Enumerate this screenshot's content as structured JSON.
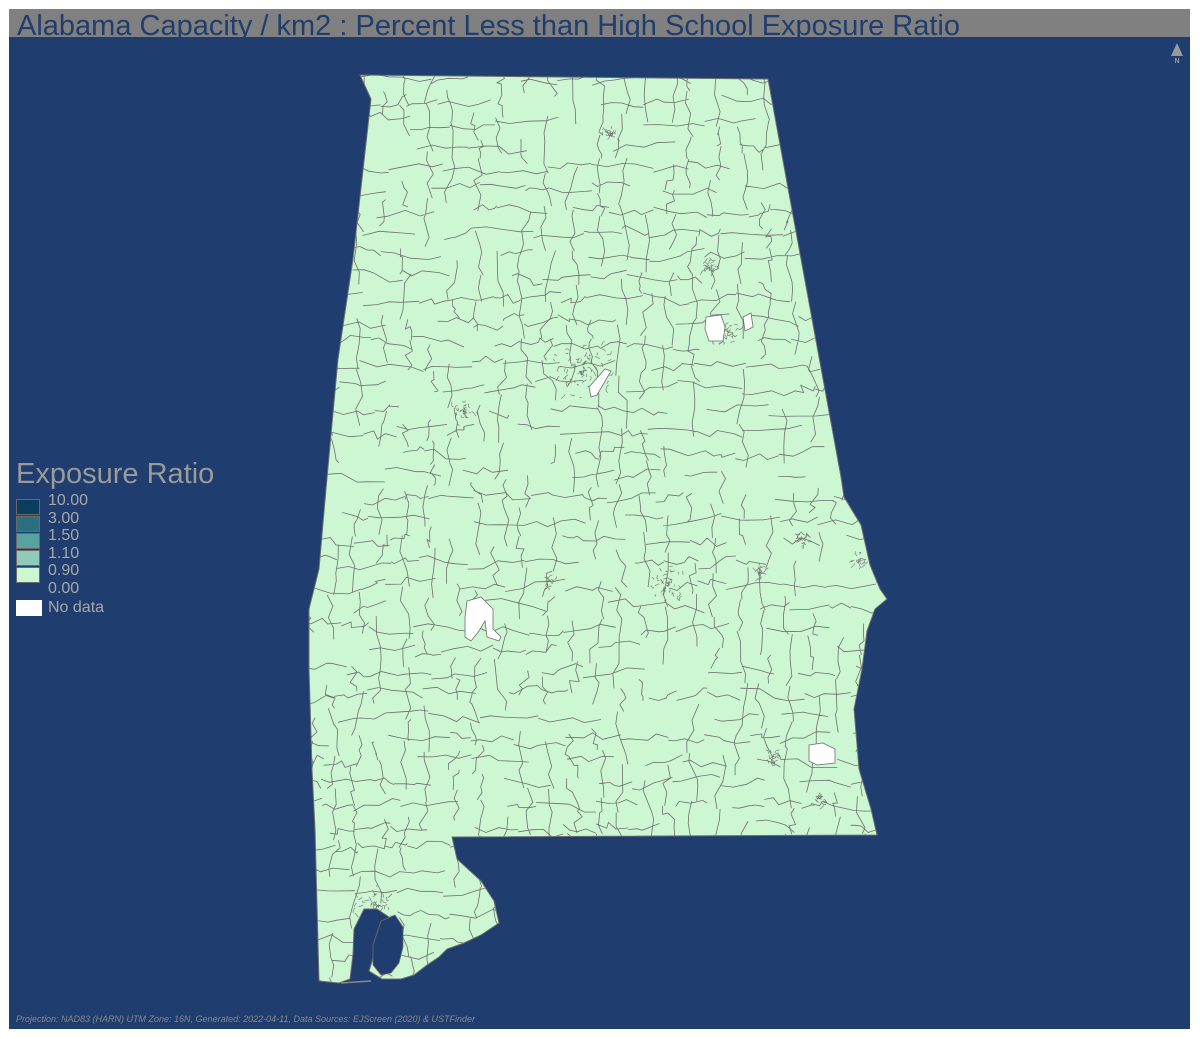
{
  "title": "Alabama Capacity / km2 : Percent Less than High School Exposure Ratio",
  "north_arrow": {
    "icon": "north-arrow-icon",
    "label": "N"
  },
  "legend": {
    "title": "Exposure Ratio",
    "classes": [
      {
        "label": "10.00",
        "color": "#0b3d5e"
      },
      {
        "label": "3.00",
        "color": "#2a7080"
      },
      {
        "label": "1.50",
        "color": "#56a3a0"
      },
      {
        "label": "1.10",
        "color": "#8fcbb8"
      },
      {
        "label": "0.90",
        "color": "#cdf7d2"
      },
      {
        "label": "0.00",
        "color": null
      }
    ],
    "no_data": {
      "label": "No data",
      "color": "#ffffff"
    }
  },
  "map": {
    "region": "Alabama",
    "unit": "census block groups",
    "fill_color": "#cdf7d2",
    "boundary_color": "#6e6e6e",
    "background_color": "#1f3d6e",
    "no_data_color": "#ffffff"
  },
  "footer": "Projection: NAD83 (HARN) UTM Zone: 16N, Generated: 2022-04-11, Data Sources: EJScreen (2020) & USTFinder"
}
